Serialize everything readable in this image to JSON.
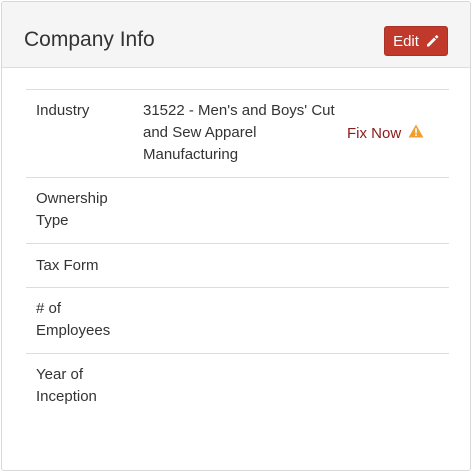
{
  "header": {
    "title": "Company Info",
    "edit_label": "Edit"
  },
  "icons": {
    "edit": "pencil-icon",
    "warning": "warning-triangle-icon"
  },
  "colors": {
    "button": "#c0392b",
    "fix_now_text": "#8b1a1a",
    "warning": "#f0a030"
  },
  "rows": [
    {
      "label": "Industry",
      "value": "31522 -  Men's and Boys' Cut and Sew Apparel Manufacturing",
      "action": "Fix Now"
    },
    {
      "label": "Ownership Type",
      "value": ""
    },
    {
      "label": "Tax Form",
      "value": ""
    },
    {
      "label": "# of Employees",
      "value": ""
    },
    {
      "label": "Year of Inception",
      "value": ""
    }
  ]
}
